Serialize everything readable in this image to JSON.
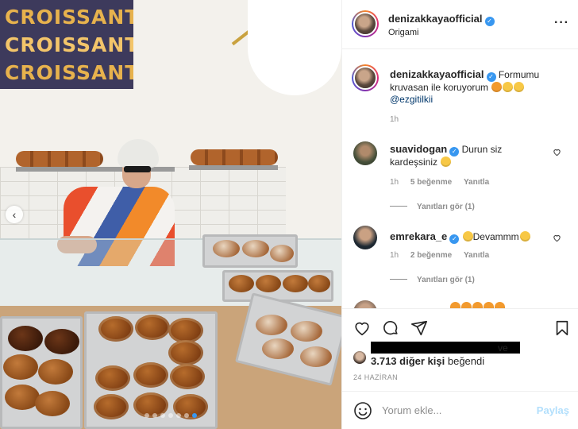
{
  "photo": {
    "banner_lines": [
      "CROISSANT",
      "CROISSANT",
      "CROISSANT"
    ],
    "carousel_prev_icon": "chevron-left-icon",
    "carousel_dots": 7,
    "active_dot": 6
  },
  "post": {
    "author": "denizakkayaofficial",
    "location": "Origami",
    "more_icon": "more-horizontal-icon",
    "caption": {
      "author": "denizakkayaofficial",
      "text": "Formumu kruvasan ile koruyorum",
      "mention": "@ezgitilkii",
      "time": "1h"
    }
  },
  "comments": [
    {
      "user": "suavidogan",
      "text": "Durun siz kardeşsiniz",
      "time": "1h",
      "likes": "5 beğenme",
      "reply": "Yanıtla",
      "view_replies": "Yanıtları gör (1)"
    },
    {
      "user": "emrekara_e",
      "text": "Devammm",
      "time": "1h",
      "likes": "2 beğenme",
      "reply": "Yanıtla",
      "view_replies": "Yanıtları gör (1)"
    }
  ],
  "engagement": {
    "connector": "ve",
    "count_text": "3.713 diğer kişi",
    "suffix": "beğendi",
    "date": "24 HAZİRAN"
  },
  "composer": {
    "placeholder": "Yorum ekle...",
    "post_label": "Paylaş"
  },
  "colors": {
    "verified": "#3897f0",
    "link": "#00376b",
    "muted": "#8e8e8e",
    "post_disabled": "#b2dffc"
  }
}
